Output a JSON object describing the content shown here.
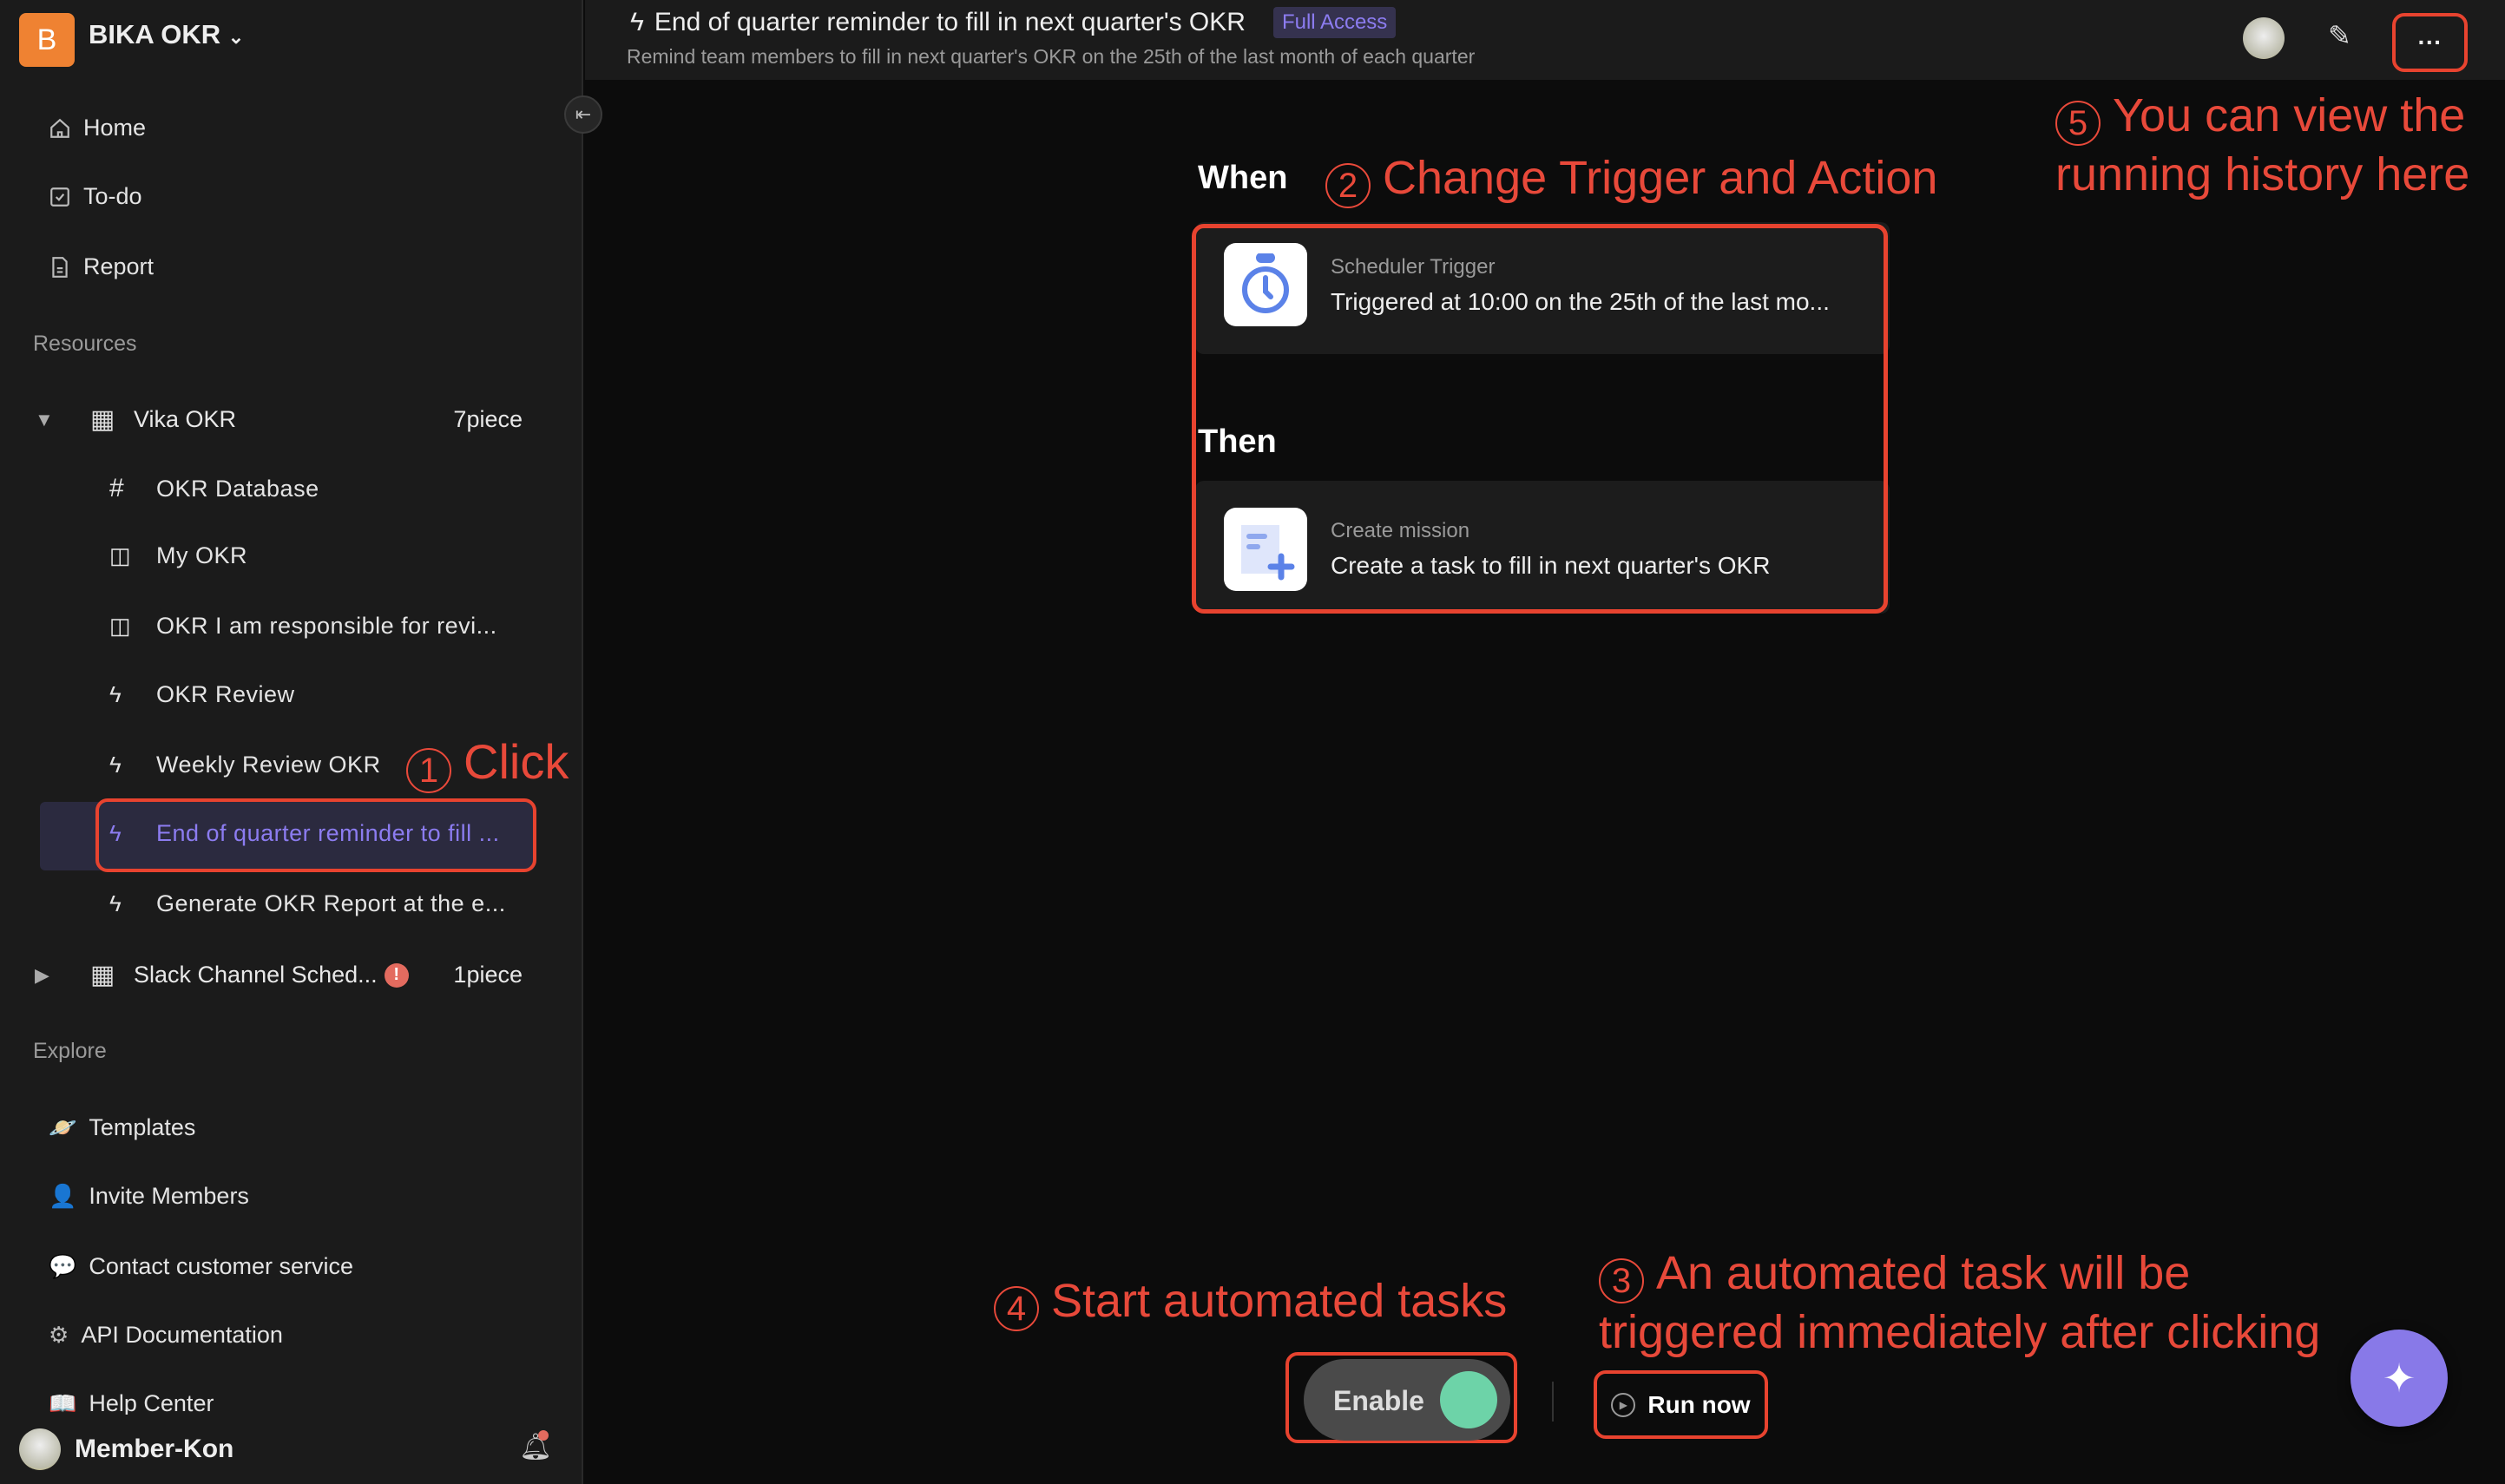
{
  "workspace": {
    "initial": "B",
    "name": "BIKA OKR"
  },
  "nav": [
    {
      "label": "Home",
      "icon": "home-icon"
    },
    {
      "label": "To-do",
      "icon": "checkbox-icon"
    },
    {
      "label": "Report",
      "icon": "document-icon"
    }
  ],
  "resources": {
    "label": "Resources",
    "folder": {
      "name": "Vika OKR",
      "count": "7piece",
      "children": [
        "OKR Database",
        "My OKR",
        "OKR I am responsible for revi...",
        "OKR Review",
        "Weekly Review OKR",
        "End of quarter reminder to fill ...",
        "Generate OKR Report at the e..."
      ]
    },
    "folder2": {
      "name": "Slack Channel Sched...",
      "count": "1piece",
      "badge": "!"
    }
  },
  "explore": {
    "label": "Explore",
    "items": [
      "Templates",
      "Invite Members",
      "Contact customer service",
      "API Documentation",
      "Help Center"
    ]
  },
  "user": {
    "name": "Member-Kon"
  },
  "header": {
    "title": "End of quarter reminder to fill in next quarter's OKR",
    "badge": "Full Access",
    "subtitle": "Remind team members to fill in next quarter's OKR on the 25th of the last month of each quarter",
    "more": "···"
  },
  "flow": {
    "when": "When",
    "then": "Then",
    "trigger": {
      "label": "Scheduler Trigger",
      "value": "Triggered at 10:00 on the 25th of the last mo..."
    },
    "action": {
      "label": "Create mission",
      "value": "Create a task to fill in next quarter's OKR"
    }
  },
  "controls": {
    "enable": "Enable",
    "enabled": true,
    "run": "Run now"
  },
  "annotations": {
    "a1": {
      "n": "1",
      "t": "Click"
    },
    "a2": {
      "n": "2",
      "t": "Change Trigger and Action"
    },
    "a3": {
      "n": "3",
      "t1": "An automated task will be",
      "t2": "triggered immediately after clicking"
    },
    "a4": {
      "n": "4",
      "t": "Start automated tasks"
    },
    "a5": {
      "n": "5",
      "t1": "You can view the",
      "t2": "running history here"
    }
  },
  "colors": {
    "accent": "#8879e8",
    "annotation": "#e8493a",
    "toggle_on": "#6dd3a8",
    "logo": "#ef8232"
  }
}
